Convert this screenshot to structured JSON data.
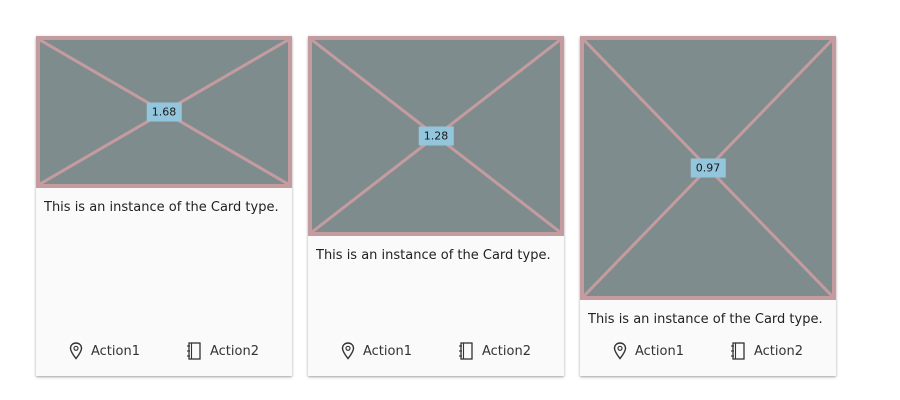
{
  "colors": {
    "media_fill": "#7f8c8d",
    "media_stroke": "#c49ca0",
    "badge_bg": "#93c6dd",
    "card_bg": "#fafafa"
  },
  "cards": [
    {
      "ratio": "1.68",
      "text": "This is an instance of the Card type.",
      "actions": [
        {
          "label": "Action1",
          "icon": "map-pin-icon"
        },
        {
          "label": "Action2",
          "icon": "notebook-icon"
        }
      ]
    },
    {
      "ratio": "1.28",
      "text": "This is an instance of the Card type.",
      "actions": [
        {
          "label": "Action1",
          "icon": "map-pin-icon"
        },
        {
          "label": "Action2",
          "icon": "notebook-icon"
        }
      ]
    },
    {
      "ratio": "0.97",
      "text": "This is an instance of the Card type.",
      "actions": [
        {
          "label": "Action1",
          "icon": "map-pin-icon"
        },
        {
          "label": "Action2",
          "icon": "notebook-icon"
        }
      ]
    }
  ]
}
